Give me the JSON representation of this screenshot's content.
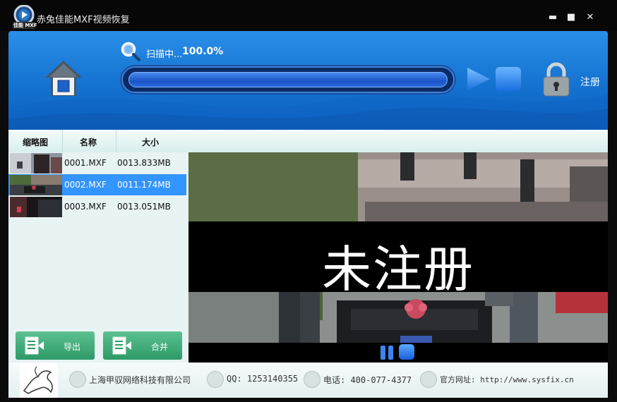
{
  "window": {
    "logo_text": "佳能 MXF",
    "title": "赤兔佳能MXF视频恢复",
    "minimize": "▬",
    "maximize": "■",
    "close": "✕"
  },
  "scan": {
    "label": "扫描中...",
    "percent_text": "100.0%",
    "progress": 1.0
  },
  "toolbar": {
    "register_label": "注册"
  },
  "list": {
    "columns": [
      "缩略图",
      "名称",
      "大小"
    ],
    "rows": [
      {
        "name": "0001.MXF",
        "size": "0013.833MB",
        "selected": false
      },
      {
        "name": "0002.MXF",
        "size": "0011.174MB",
        "selected": true
      },
      {
        "name": "0003.MXF",
        "size": "0013.051MB",
        "selected": false
      }
    ]
  },
  "actions": {
    "export_label": "导出",
    "merge_label": "合并"
  },
  "preview": {
    "watermark": "未注册"
  },
  "footer": {
    "company": "上海甲驭网络科技有限公司",
    "qq": "QQ: 1253140355",
    "phone": "电话: 400-077-4377",
    "website": "官方网址: http://www.sysfix.cn"
  },
  "colors": {
    "toolbar_blue": "#1472d0",
    "selection_blue": "#3395ff",
    "button_green": "#2d9a68"
  }
}
